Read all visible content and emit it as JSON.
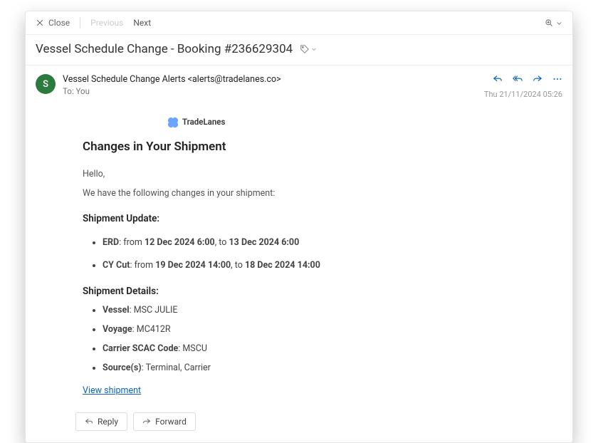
{
  "toolbar": {
    "close": "Close",
    "previous": "Previous",
    "next": "Next"
  },
  "subject": "Vessel Schedule Change - Booking #236629304",
  "sender": {
    "initial": "S",
    "display": "Vessel Schedule Change Alerts <alerts@tradelanes.co>",
    "to_label": "To:",
    "to_value": "You"
  },
  "meta": {
    "date": "Thu 21/11/2024 05:26"
  },
  "brand": {
    "name": "TradeLanes"
  },
  "body": {
    "title": "Changes in Your Shipment",
    "greeting": "Hello,",
    "intro": "We have the following changes in your shipment:",
    "shipment_update_heading": "Shipment Update:",
    "updates": [
      {
        "label": "ERD",
        "from": "12 Dec 2024 6:00",
        "to": "13 Dec 2024 6:00"
      },
      {
        "label": "CY Cut",
        "from": "19 Dec 2024 14:00",
        "to": "18 Dec 2024 14:00"
      }
    ],
    "details_heading": "Shipment Details:",
    "details": [
      {
        "label": "Vessel",
        "value": "MSC JULIE"
      },
      {
        "label": "Voyage",
        "value": "MC412R"
      },
      {
        "label": "Carrier SCAC Code",
        "value": "MSCU"
      },
      {
        "label": "Source(s)",
        "value": "Terminal, Carrier"
      }
    ],
    "link_text": "View shipment"
  },
  "footer": {
    "reply": "Reply",
    "forward": "Forward"
  }
}
